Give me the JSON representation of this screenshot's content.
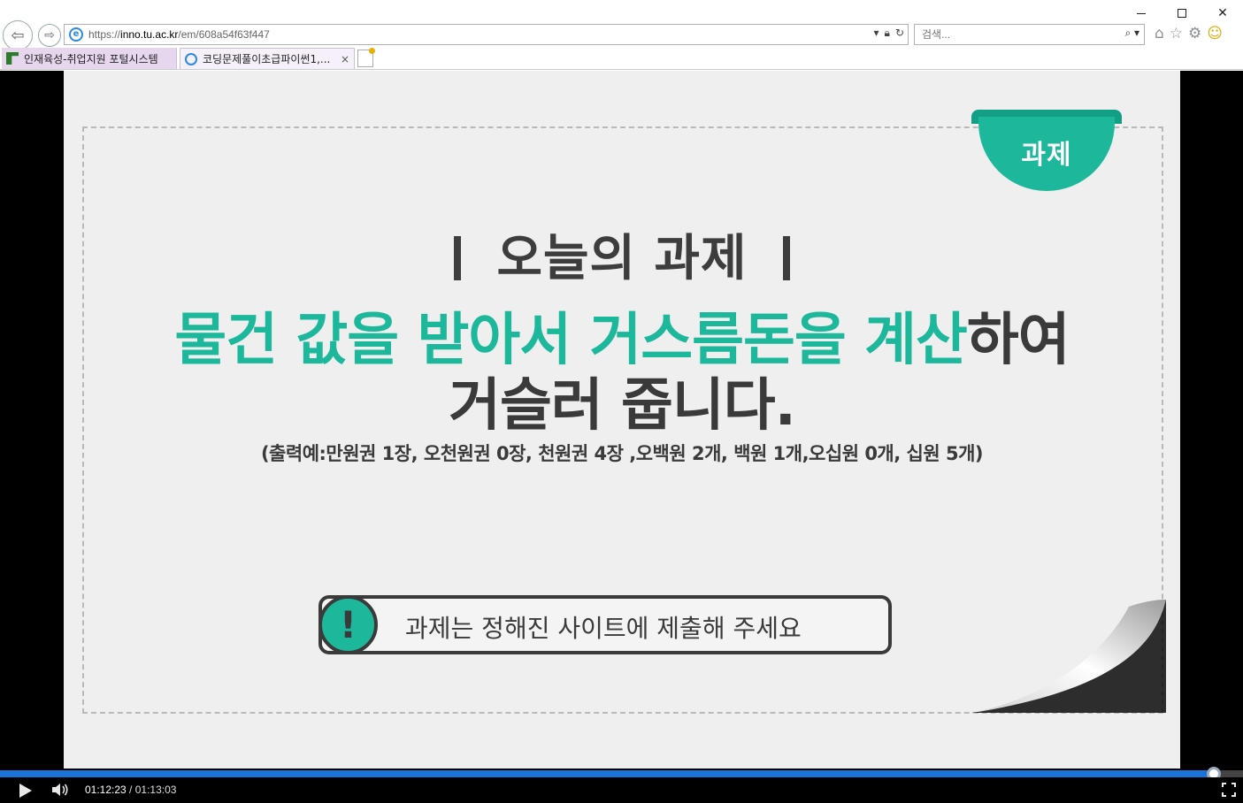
{
  "browser": {
    "url_prefix": "https://",
    "url_host": "inno.tu.ac.kr",
    "url_path": "/em/608a54f63f447",
    "search_placeholder": "검색...",
    "icons": [
      "back-icon",
      "forward-icon",
      "dropdown-icon",
      "lock-icon",
      "refresh-icon",
      "search-icon",
      "home-icon",
      "star-icon",
      "gear-icon",
      "smiley-icon"
    ],
    "tabs": [
      {
        "label": "인재육성-취업지원 포털시스템",
        "active": false
      },
      {
        "label": "코딩문제풀이초급파이썬1,...",
        "active": true
      }
    ],
    "tab_close_symbol": "×"
  },
  "slide": {
    "badge": "과제",
    "title": "오늘의 과제",
    "headline_green": "물건 값을 받아서 거스름돈을 계산",
    "headline_dark_1": "하여",
    "headline_dark_2": "거슬러 줍니다.",
    "example": "(출력예:만원권 1장, 오천원권 0장, 천원권 4장 ,오백원 2개, 백원 1개,오십원 0개, 십원 5개)",
    "notice_icon": "!",
    "notice_text": "과제는 정해진 사이트에 제출해 주세요"
  },
  "player": {
    "current_time": "01:12:23",
    "separator": " / ",
    "duration": "01:13:03",
    "progress_fraction": 0.9909
  },
  "colors": {
    "accent_green": "#1db89c",
    "text_dark": "#3a3a3a",
    "progress_blue": "#1a73d9"
  }
}
